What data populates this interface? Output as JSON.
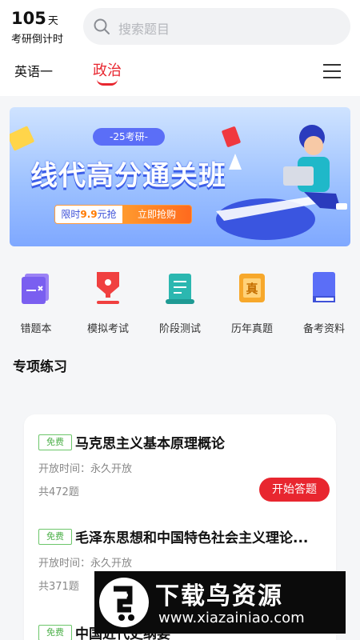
{
  "header": {
    "countdown_number": "105",
    "countdown_unit": "天",
    "countdown_label": "考研倒计时",
    "search_placeholder": "搜索题目"
  },
  "subjects": [
    {
      "label": "英语一",
      "active": false
    },
    {
      "label": "政治",
      "active": true
    }
  ],
  "banner": {
    "tag": "25考研",
    "title": "线代高分通关班",
    "promo_prefix": "限时",
    "promo_price": "9.9",
    "promo_suffix": "元抢",
    "promo_button": "立即抢购"
  },
  "shortcuts": [
    {
      "label": "错题本",
      "icon": "wrong-book-icon",
      "color": "#8b6ff0"
    },
    {
      "label": "模拟考试",
      "icon": "mock-exam-icon",
      "color": "#f04040"
    },
    {
      "label": "阶段测试",
      "icon": "stage-test-icon",
      "color": "#2bb7b0"
    },
    {
      "label": "历年真题",
      "icon": "past-papers-icon",
      "color": "#f7a82b"
    },
    {
      "label": "备考资料",
      "icon": "materials-icon",
      "color": "#5b6ef7"
    }
  ],
  "section": {
    "title": "专项练习"
  },
  "practice_items": [
    {
      "badge": "免费",
      "title": "马克思主义基本原理概论",
      "open_time": "开放时间：永久开放",
      "count": "共472题",
      "button": "开始答题"
    },
    {
      "badge": "免费",
      "title": "毛泽东思想和中国特色社会主义理论...",
      "open_time": "开放时间：永久开放",
      "count": "共371题"
    },
    {
      "badge": "免费",
      "title": "中国近代史纲要"
    }
  ],
  "watermark": {
    "title": "下载鸟资源",
    "url": "www.xiazainiao.com"
  },
  "colors": {
    "accent": "#e8262f",
    "free_green": "#4db04a"
  }
}
